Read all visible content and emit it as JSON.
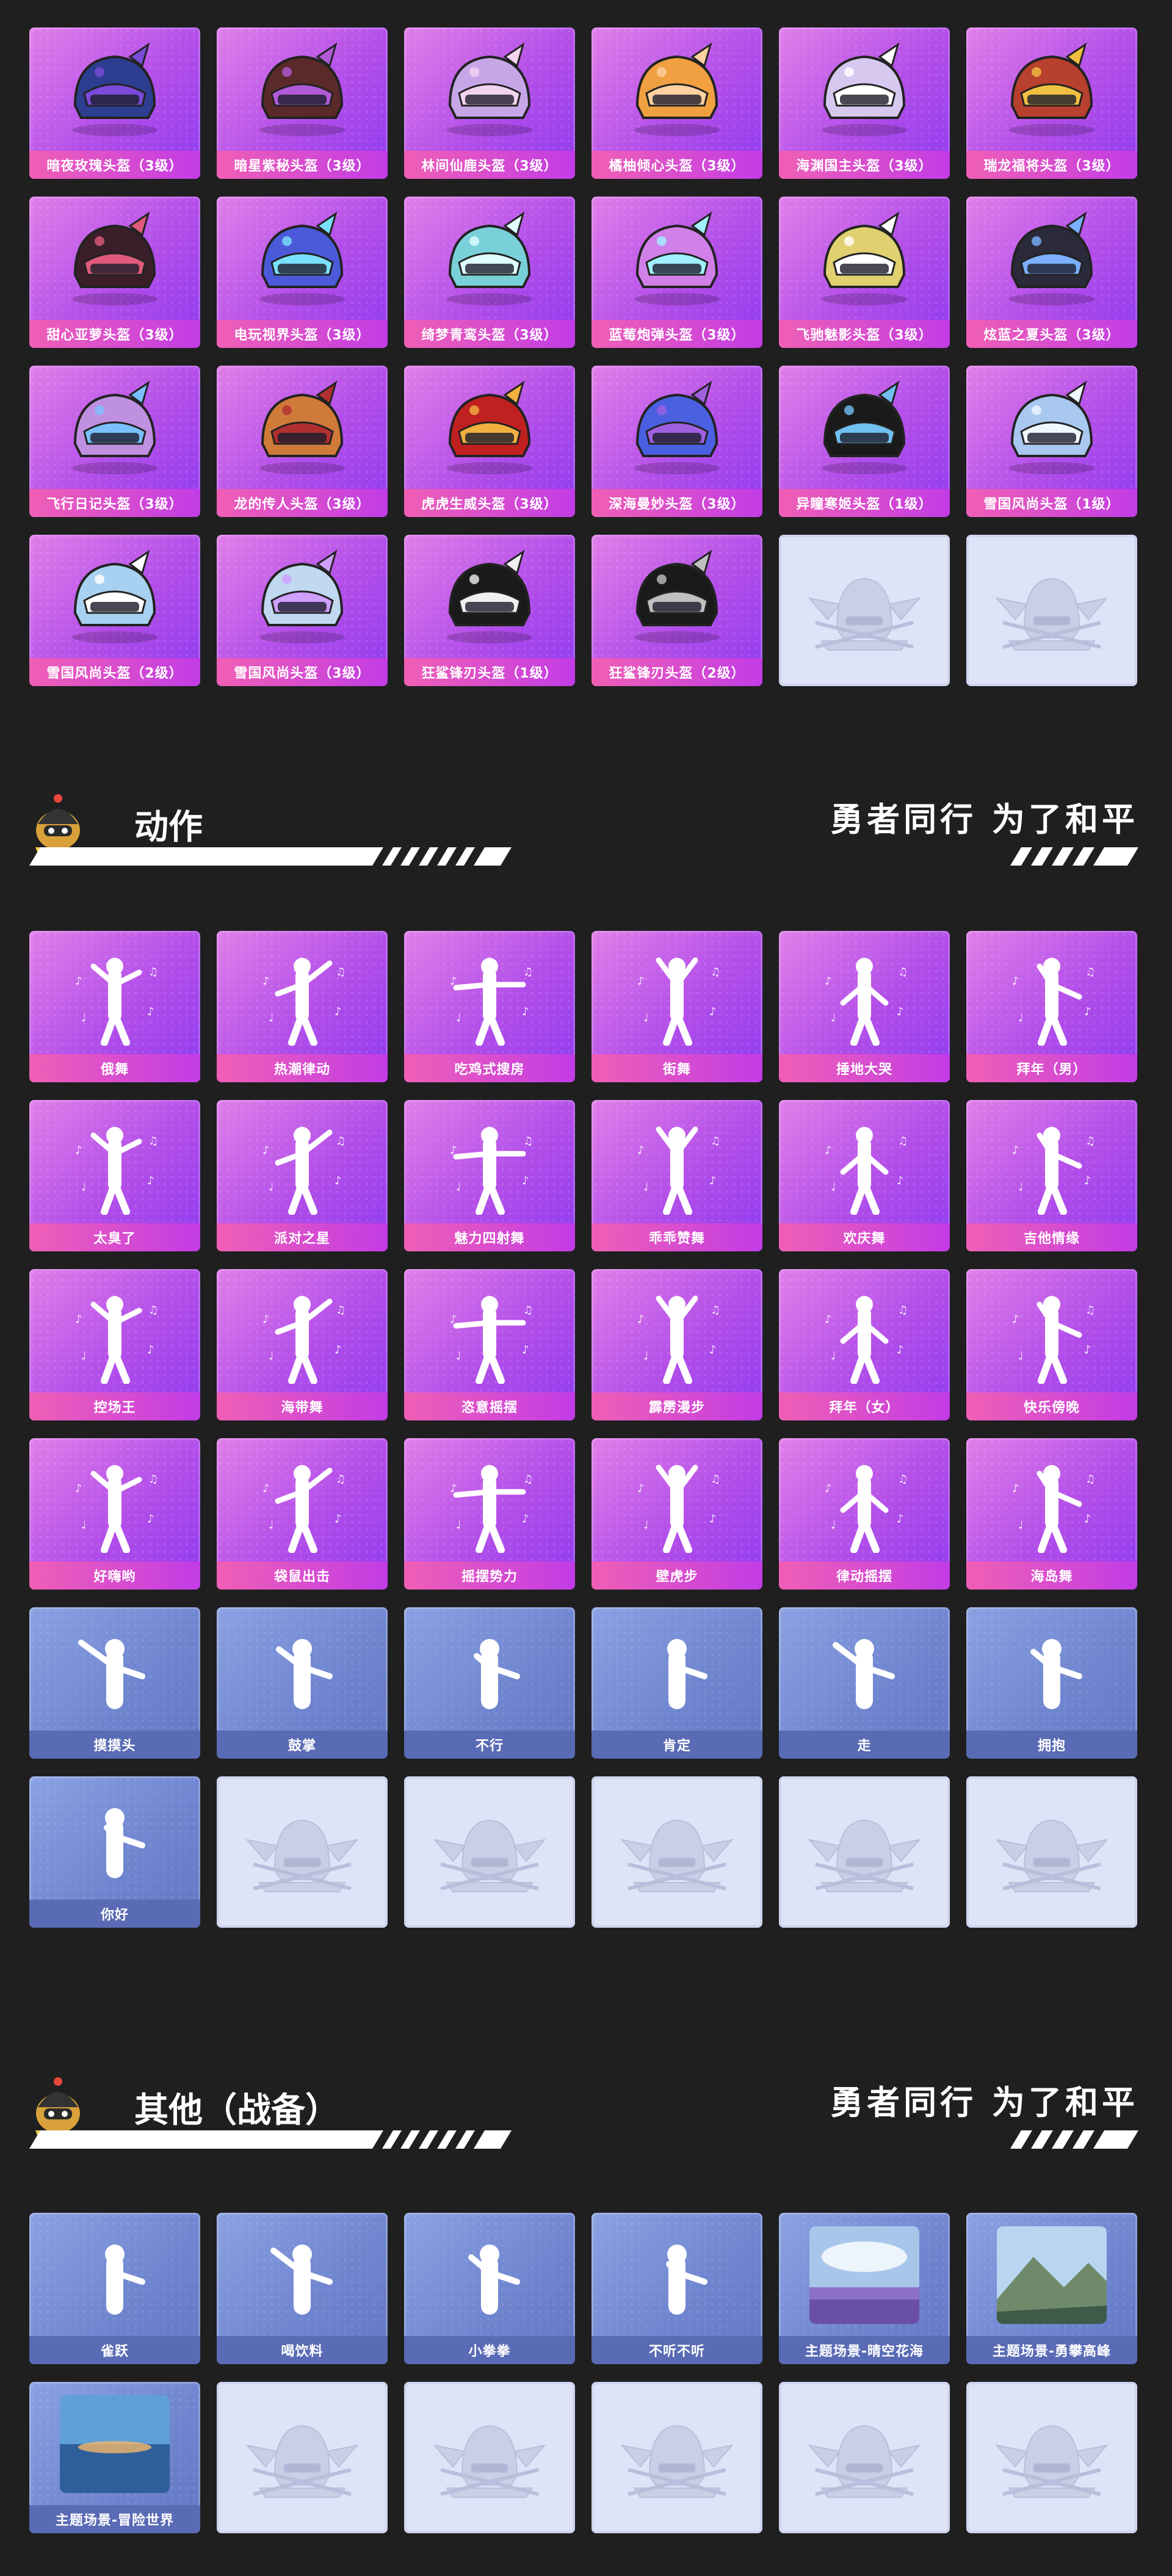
{
  "helmets": [
    "暗夜玫瑰头盔（3级）",
    "暗星紫秘头盔（3级）",
    "林间仙鹿头盔（3级）",
    "橘柚倾心头盔（3级）",
    "海渊国主头盔（3级）",
    "瑞龙福将头盔（3级）",
    "甜心亚萝头盔（3级）",
    "电玩视界头盔（3级）",
    "绮梦青鸾头盔（3级）",
    "蓝莓炮弹头盔（3级）",
    "飞驰魅影头盔（3级）",
    "炫蓝之夏头盔（3级）",
    "飞行日记头盔（3级）",
    "龙的传人头盔（3级）",
    "虎虎生威头盔（3级）",
    "深海曼妙头盔（3级）",
    "异瞳寒姬头盔（1级）",
    "雪国风尚头盔（1级）",
    "雪国风尚头盔（2级）",
    "雪国风尚头盔（3级）",
    "狂鲨锋刃头盔（1级）",
    "狂鲨锋刃头盔（2级）"
  ],
  "section_actions": {
    "title": "动作",
    "slogan": "勇者同行 为了和平"
  },
  "actions_purple": [
    "俄舞",
    "热潮律动",
    "吃鸡式搜房",
    "街舞",
    "捶地大哭",
    "拜年（男）",
    "太臭了",
    "派对之星",
    "魅力四射舞",
    "乖乖赞舞",
    "欢庆舞",
    "吉他情缘",
    "控场王",
    "海带舞",
    "恣意摇摆",
    "霹雳漫步",
    "拜年（女）",
    "快乐傍晚",
    "好嗨哟",
    "袋鼠出击",
    "摇摆势力",
    "壁虎步",
    "律动摇摆",
    "海岛舞"
  ],
  "actions_blue": [
    "摸摸头",
    "鼓掌",
    "不行",
    "肯定",
    "走",
    "拥抱",
    "你好"
  ],
  "section_other": {
    "title": "其他（战备）",
    "slogan": "勇者同行 为了和平"
  },
  "other_items": [
    "雀跃",
    "喝饮料",
    "小拳拳",
    "不听不听",
    "主题场景-晴空花海",
    "主题场景-勇攀高峰",
    "主题场景-冒险世界"
  ],
  "colors": {
    "background": "#1f1f20",
    "purple_card": "#b24ee9",
    "blue_card": "#6f84cf",
    "empty_card": "#dfe3f7"
  }
}
